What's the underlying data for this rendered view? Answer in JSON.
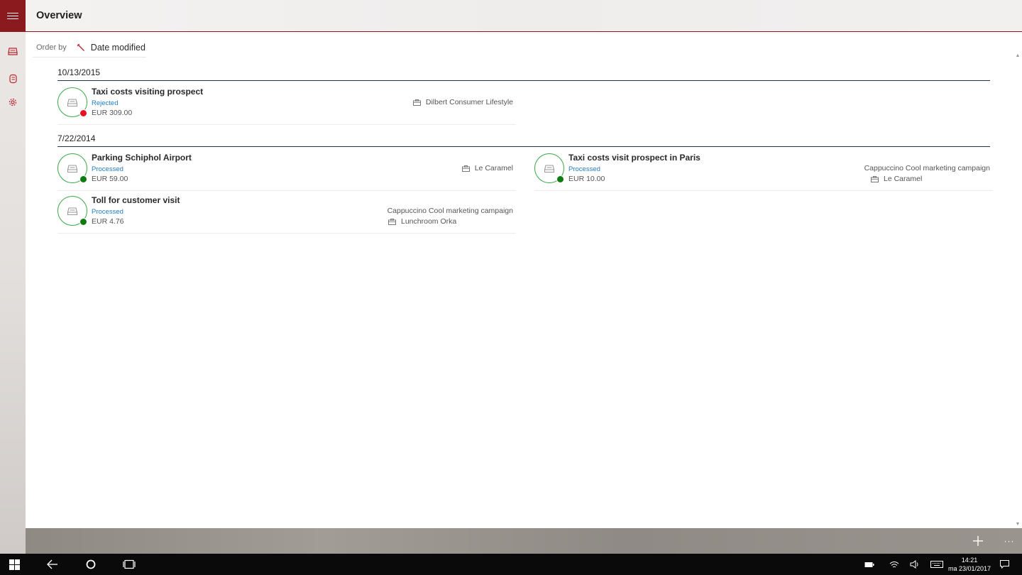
{
  "header": {
    "title": "Overview"
  },
  "sidebar": {
    "items": [
      {
        "icon": "receipt-icon"
      },
      {
        "icon": "expense-report-icon"
      },
      {
        "icon": "gear-icon"
      }
    ]
  },
  "order": {
    "label": "Order by",
    "value": "Date modified"
  },
  "groups": [
    {
      "date": "10/13/2015",
      "expenses": [
        {
          "title": "Taxi costs visiting prospect",
          "status": "Rejected",
          "amount": "EUR 309.00",
          "project": "",
          "location": "Dilbert Consumer Lifestyle",
          "status_color": "#e81123"
        }
      ]
    },
    {
      "date": "7/22/2014",
      "expenses": [
        {
          "title": "Parking Schiphol Airport",
          "status": "Processed",
          "amount": "EUR 59.00",
          "project": "",
          "location": "Le Caramel",
          "status_color": "#107c10"
        },
        {
          "title": "Taxi costs visit prospect in Paris",
          "status": "Processed",
          "amount": "EUR 10.00",
          "project": "Cappuccino Cool marketing campaign",
          "location": "Le Caramel",
          "status_color": "#107c10"
        },
        {
          "title": "Toll for customer visit",
          "status": "Processed",
          "amount": "EUR 4.76",
          "project": "Cappuccino Cool marketing campaign",
          "location": "Lunchroom Orka",
          "status_color": "#107c10"
        }
      ]
    }
  ],
  "commandbar": {
    "add_icon": "plus-icon",
    "more_label": "···"
  },
  "taskbar": {
    "time": "14:21",
    "date": "ma 23/01/2017"
  },
  "colors": {
    "accent": "#8b1a1f",
    "link": "#1f7cc4",
    "ring": "#3aa84a"
  }
}
